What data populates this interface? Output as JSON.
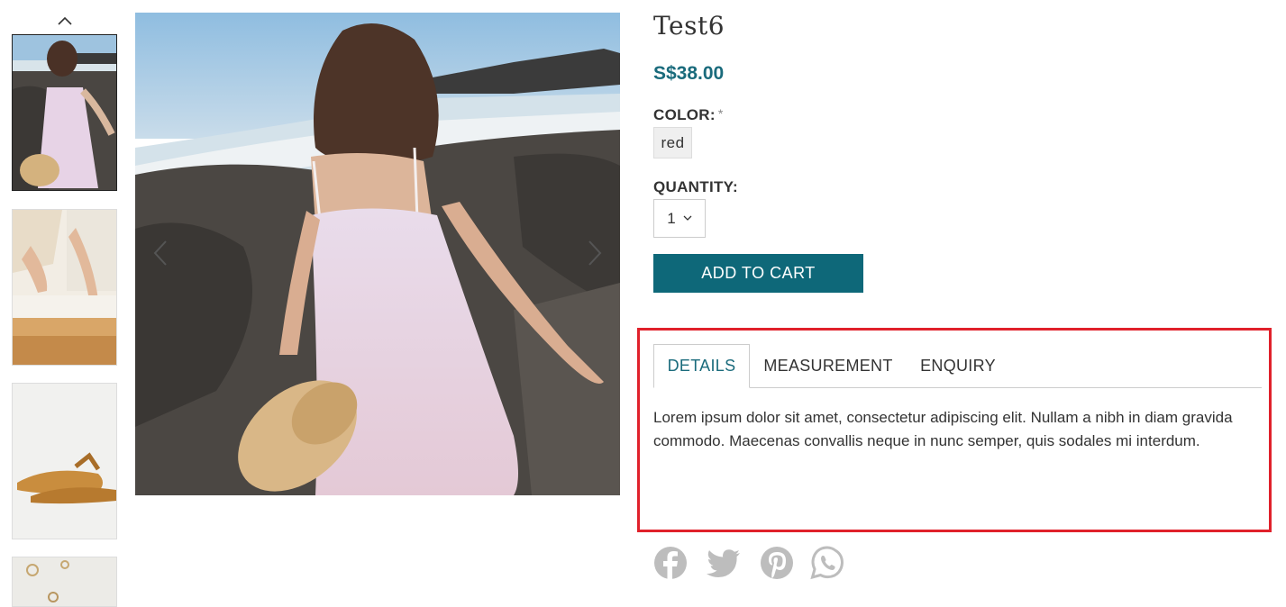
{
  "product": {
    "title": "Test6",
    "price": "S$38.00",
    "color_label": "COLOR:",
    "required_mark": "*",
    "color_value": "red",
    "quantity_label": "QUANTITY:",
    "quantity_value": "1",
    "add_to_cart": "ADD TO CART"
  },
  "tabs": [
    {
      "label": "DETAILS",
      "active": true
    },
    {
      "label": "MEASUREMENT",
      "active": false
    },
    {
      "label": "ENQUIRY",
      "active": false
    }
  ],
  "details_text": "Lorem ipsum dolor sit amet, consectetur adipiscing elit. Nullam a nibh in diam gravida commodo. Maecenas convallis neque in nunc semper, quis sodales mi interdum.",
  "share_icons": [
    "facebook-icon",
    "twitter-icon",
    "pinterest-icon",
    "whatsapp-icon"
  ],
  "colors": {
    "accent": "#0e6879",
    "price": "#1a6b7c",
    "highlight": "#e0212b",
    "share_icon": "#bdbdbd"
  }
}
